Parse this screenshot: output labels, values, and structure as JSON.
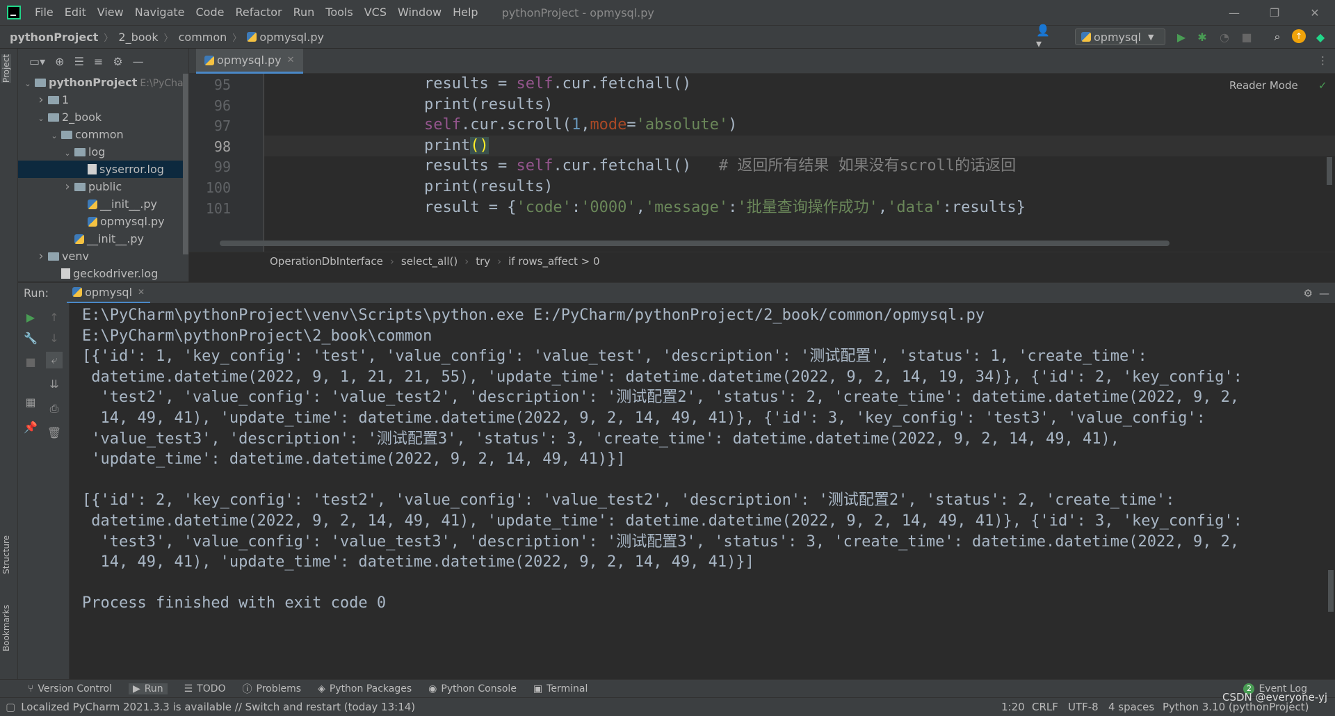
{
  "app": {
    "window_title": "pythonProject - opmysql.py",
    "menu": [
      "File",
      "Edit",
      "View",
      "Navigate",
      "Code",
      "Refactor",
      "Run",
      "Tools",
      "VCS",
      "Window",
      "Help"
    ]
  },
  "navbar": {
    "crumbs": [
      "pythonProject",
      "2_book",
      "common",
      "opmysql.py"
    ],
    "run_config": "opmysql"
  },
  "left_strip": {
    "project": "Project",
    "structure": "Structure",
    "bookmarks": "Bookmarks"
  },
  "project_tree": [
    {
      "label": "pythonProject",
      "hint": "E:\\PyCharm",
      "indent": 0,
      "type": "folder",
      "arrow": "down",
      "bold": true
    },
    {
      "label": "1",
      "indent": 1,
      "type": "folder",
      "arrow": "right"
    },
    {
      "label": "2_book",
      "indent": 1,
      "type": "folder",
      "arrow": "down"
    },
    {
      "label": "common",
      "indent": 2,
      "type": "folder",
      "arrow": "down"
    },
    {
      "label": "log",
      "indent": 3,
      "type": "folder",
      "arrow": "down"
    },
    {
      "label": "syserror.log",
      "indent": 4,
      "type": "log",
      "arrow": "",
      "selected": true
    },
    {
      "label": "public",
      "indent": 3,
      "type": "folder",
      "arrow": "right"
    },
    {
      "label": "__init__.py",
      "indent": 4,
      "type": "py",
      "arrow": ""
    },
    {
      "label": "opmysql.py",
      "indent": 4,
      "type": "py",
      "arrow": ""
    },
    {
      "label": "__init__.py",
      "indent": 3,
      "type": "py",
      "arrow": ""
    },
    {
      "label": "venv",
      "indent": 1,
      "type": "folder",
      "arrow": "right"
    },
    {
      "label": "geckodriver.log",
      "indent": 2,
      "type": "log",
      "arrow": ""
    }
  ],
  "editor": {
    "tab": "opmysql.py",
    "reader_mode": "Reader Mode",
    "lines": [
      {
        "n": "95",
        "current": false,
        "tokens": [
          [
            "fn",
            "results = "
          ],
          [
            "self",
            "self"
          ],
          [
            "fn",
            ".cur.fetchall()"
          ]
        ]
      },
      {
        "n": "96",
        "current": false,
        "tokens": [
          [
            "fn",
            "print(results)"
          ]
        ]
      },
      {
        "n": "97",
        "current": false,
        "tokens": [
          [
            "self",
            "self"
          ],
          [
            "fn",
            ".cur.scroll("
          ],
          [
            "num",
            "1"
          ],
          [
            "fn",
            ","
          ],
          [
            "param",
            "mode"
          ],
          [
            "fn",
            "="
          ],
          [
            "str",
            "'absolute'"
          ],
          [
            "fn",
            ")"
          ]
        ]
      },
      {
        "n": "98",
        "current": true,
        "tokens": [
          [
            "fn",
            "print"
          ],
          [
            "hl",
            "()"
          ]
        ]
      },
      {
        "n": "99",
        "current": false,
        "tokens": [
          [
            "fn",
            "results = "
          ],
          [
            "self",
            "self"
          ],
          [
            "fn",
            ".cur.fetchall()   "
          ],
          [
            "comment",
            "# 返回所有结果 如果没有scroll的话返回"
          ]
        ]
      },
      {
        "n": "100",
        "current": false,
        "tokens": [
          [
            "fn",
            "print(results)"
          ]
        ]
      },
      {
        "n": "101",
        "current": false,
        "tokens": [
          [
            "fn",
            "result = {"
          ],
          [
            "str",
            "'code'"
          ],
          [
            "fn",
            ":"
          ],
          [
            "str",
            "'0000'"
          ],
          [
            "fn",
            ","
          ],
          [
            "str",
            "'message'"
          ],
          [
            "fn",
            ":"
          ],
          [
            "str",
            "'批量查询操作成功'"
          ],
          [
            "fn",
            ","
          ],
          [
            "str",
            "'data'"
          ],
          [
            "fn",
            ":results}"
          ]
        ]
      }
    ],
    "breadcrumbs": [
      "OperationDbInterface",
      "select_all()",
      "try",
      "if rows_affect > 0"
    ]
  },
  "run": {
    "label": "Run:",
    "tab": "opmysql",
    "console": [
      "E:\\PyCharm\\pythonProject\\venv\\Scripts\\python.exe E:/PyCharm/pythonProject/2_book/common/opmysql.py",
      "E:\\PyCharm\\pythonProject\\2_book\\common",
      "[{'id': 1, 'key_config': 'test', 'value_config': 'value_test', 'description': '测试配置', 'status': 1, 'create_time':",
      " datetime.datetime(2022, 9, 1, 21, 21, 55), 'update_time': datetime.datetime(2022, 9, 2, 14, 19, 34)}, {'id': 2, 'key_config':",
      "  'test2', 'value_config': 'value_test2', 'description': '测试配置2', 'status': 2, 'create_time': datetime.datetime(2022, 9, 2,",
      "  14, 49, 41), 'update_time': datetime.datetime(2022, 9, 2, 14, 49, 41)}, {'id': 3, 'key_config': 'test3', 'value_config':",
      " 'value_test3', 'description': '测试配置3', 'status': 3, 'create_time': datetime.datetime(2022, 9, 2, 14, 49, 41),",
      " 'update_time': datetime.datetime(2022, 9, 2, 14, 49, 41)}]",
      "",
      "[{'id': 2, 'key_config': 'test2', 'value_config': 'value_test2', 'description': '测试配置2', 'status': 2, 'create_time':",
      " datetime.datetime(2022, 9, 2, 14, 49, 41), 'update_time': datetime.datetime(2022, 9, 2, 14, 49, 41)}, {'id': 3, 'key_config':",
      "  'test3', 'value_config': 'value_test3', 'description': '测试配置3', 'status': 3, 'create_time': datetime.datetime(2022, 9, 2,",
      "  14, 49, 41), 'update_time': datetime.datetime(2022, 9, 2, 14, 49, 41)}]",
      "",
      "Process finished with exit code 0"
    ]
  },
  "toolwindows": [
    "Version Control",
    "Run",
    "TODO",
    "Problems",
    "Python Packages",
    "Python Console",
    "Terminal"
  ],
  "event_log": {
    "count": "2",
    "label": "Event Log"
  },
  "status": {
    "message": "Localized PyCharm 2021.3.3 is available // Switch and restart (today 13:14)",
    "position": "1:20",
    "line_sep": "CRLF",
    "encoding": "UTF-8",
    "indent": "4 spaces",
    "interpreter": "Python 3.10 (pythonProject)",
    "watermark": "CSDN @everyone-yj"
  },
  "colors": {
    "accent": "#4a88c7",
    "selection": "#0d293e",
    "run_green": "#499c54"
  }
}
